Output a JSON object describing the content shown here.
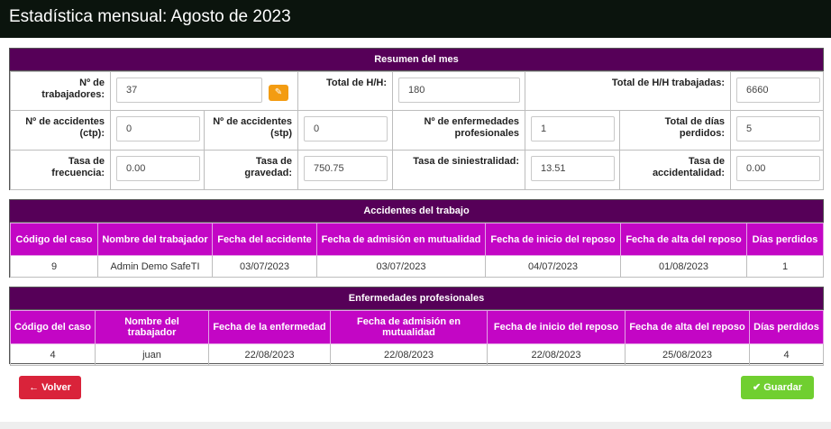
{
  "header": {
    "title": "Estadística mensual: Agosto de 2023"
  },
  "summary": {
    "title": "Resumen del mes",
    "workers_label": "Nº de trabajadores:",
    "workers_value": "37",
    "total_hh_label": "Total de H/H:",
    "total_hh_value": "180",
    "total_hh_worked_label": "Total de H/H trabajadas:",
    "total_hh_worked_value": "6660",
    "accidents_ctp_label": "Nº de accidentes (ctp):",
    "accidents_ctp_value": "0",
    "accidents_stp_label": "Nº de accidentes (stp)",
    "accidents_stp_value": "0",
    "occ_diseases_label": "Nº de enfermedades profesionales",
    "occ_diseases_value": "1",
    "lost_days_label": "Total de días perdidos:",
    "lost_days_value": "5",
    "freq_rate_label": "Tasa de frecuencia:",
    "freq_rate_value": "0.00",
    "severity_rate_label": "Tasa de gravedad:",
    "severity_rate_value": "750.75",
    "loss_rate_label": "Tasa de siniestralidad:",
    "loss_rate_value": "13.51",
    "accident_rate_label": "Tasa de accidentalidad:",
    "accident_rate_value": "0.00"
  },
  "accidents": {
    "title": "Accidentes del trabajo",
    "columns": [
      "Código del caso",
      "Nombre del trabajador",
      "Fecha del accidente",
      "Fecha de admisión en mutualidad",
      "Fecha de inicio del reposo",
      "Fecha de alta del reposo",
      "Días perdidos"
    ],
    "rows": [
      [
        "9",
        "Admin Demo SafeTI",
        "03/07/2023",
        "03/07/2023",
        "04/07/2023",
        "01/08/2023",
        "1"
      ]
    ]
  },
  "diseases": {
    "title": "Enfermedades profesionales",
    "columns": [
      "Código del caso",
      "Nombre del trabajador",
      "Fecha de la enfermedad",
      "Fecha de admisión en mutualidad",
      "Fecha de inicio del reposo",
      "Fecha de alta del reposo",
      "Días perdidos"
    ],
    "rows": [
      [
        "4",
        "juan",
        "22/08/2023",
        "22/08/2023",
        "22/08/2023",
        "25/08/2023",
        "4"
      ]
    ]
  },
  "actions": {
    "back_label": "Volver",
    "back_icon": "arrow-left-icon",
    "save_label": "Guardar",
    "save_icon": "check-icon"
  },
  "colors": {
    "header_bg": "#0b140d",
    "panel_head": "#560058",
    "table_head": "#c306c5",
    "back_button": "#d9233a",
    "save_button": "#70cf30",
    "edit_button": "#f39c12"
  }
}
